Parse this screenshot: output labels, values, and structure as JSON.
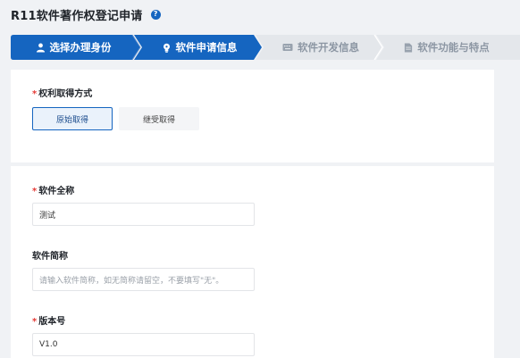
{
  "page": {
    "title": "R11软件著作权登记申请",
    "help_icon": "question-circle-icon"
  },
  "steps": [
    {
      "label": "选择办理身份",
      "icon": "user-icon",
      "state": "completed"
    },
    {
      "label": "软件申请信息",
      "icon": "lightbulb-icon",
      "state": "current"
    },
    {
      "label": "软件开发信息",
      "icon": "keyboard-icon",
      "state": "pending"
    },
    {
      "label": "软件功能与特点",
      "icon": "document-icon",
      "state": "pending"
    }
  ],
  "colors": {
    "accent": "#1565c0",
    "step_inactive_bg": "#e4e7eb",
    "required": "#e53935"
  },
  "rights": {
    "label": "权利取得方式",
    "required": "*",
    "options": [
      {
        "label": "原始取得",
        "selected": true
      },
      {
        "label": "继受取得",
        "selected": false
      }
    ]
  },
  "fields": {
    "full_name": {
      "label": "软件全称",
      "required": "*",
      "value": "测试",
      "placeholder": ""
    },
    "short_name": {
      "label": "软件简称",
      "required": "",
      "value": "",
      "placeholder": "请输入软件简称，如无简称请留空，不要填写\"无\"。"
    },
    "version": {
      "label": "版本号",
      "required": "*",
      "value": "V1.0",
      "placeholder": ""
    }
  }
}
